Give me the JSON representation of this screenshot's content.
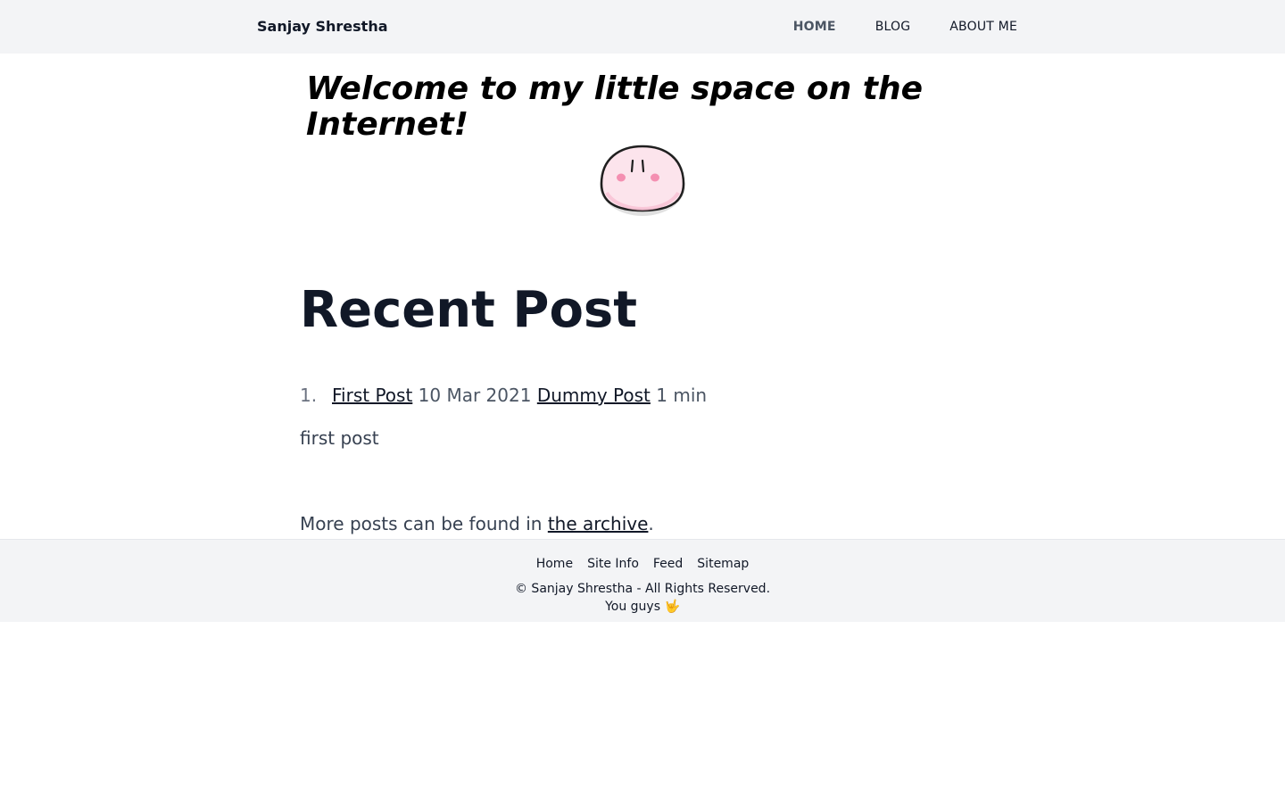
{
  "header": {
    "brand": "Sanjay Shrestha",
    "nav": [
      {
        "label": "HOME",
        "active": true
      },
      {
        "label": "BLOG",
        "active": false
      },
      {
        "label": "ABOUT ME",
        "active": false
      }
    ]
  },
  "hero": {
    "title": "Welcome to my little space on the Internet!",
    "mascot_icon": "pink-dango-mascot"
  },
  "recent": {
    "title": "Recent Post",
    "posts": [
      {
        "number": "1.",
        "title": "First Post",
        "date": "10 Mar 2021",
        "category": "Dummy Post",
        "read_time": "1 min",
        "summary": "first post"
      }
    ],
    "more_prefix": "More posts can be found in ",
    "more_link": "the archive",
    "more_suffix": "."
  },
  "footer": {
    "links": [
      "Home",
      "Site Info",
      "Feed",
      "Sitemap"
    ],
    "copyright": "© Sanjay Shrestha - All Rights Reserved.",
    "tagline": "You guys 🤟"
  },
  "colors": {
    "header_bg": "#f3f4f6",
    "footer_bg": "#f3f4f6",
    "text": "#111827",
    "muted": "#4b5563",
    "mascot_fill": "#fce4ec",
    "mascot_cheek": "#f48fb1"
  }
}
